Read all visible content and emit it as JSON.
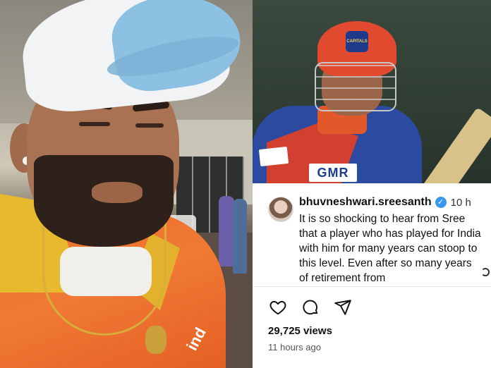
{
  "post": {
    "username": "bhuvneshwari.sreesanth",
    "time": "10 h",
    "caption": "It is so shocking to hear from Sree that a player who has played for India with him for many years can stoop to this level. Even after so many years of retirement from",
    "views": "29,725 views",
    "posted_ago": "11 hours ago"
  },
  "photos": {
    "right": {
      "sponsor": "GMR",
      "badge": "CAPITALS"
    }
  },
  "icons": {
    "like": "heart-icon",
    "comment": "comment-icon",
    "share": "share-icon",
    "verified": "verified-badge-icon"
  },
  "colors": {
    "verified": "#3897f0",
    "text": "#111111"
  }
}
